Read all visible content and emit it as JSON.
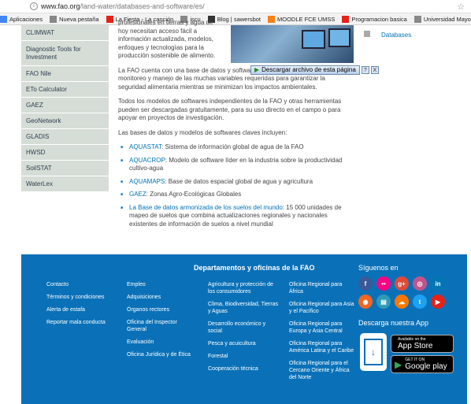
{
  "browser": {
    "url_host": "www.fao.org",
    "url_path": "/land-water/databases-and-software/es/",
    "bookmarks": [
      {
        "label": "Aplicaciones",
        "icon": "apps-icon",
        "color": "#4285f4"
      },
      {
        "label": "Nueva pestaña",
        "icon": "page-icon",
        "color": "#888888"
      },
      {
        "label": "La Fiesta - La canción",
        "icon": "youtube-icon",
        "color": "#e62117"
      },
      {
        "label": "iscu",
        "icon": "page-icon",
        "color": "#888888"
      },
      {
        "label": "Blog | sawersbot",
        "icon": "blog-icon",
        "color": "#333333"
      },
      {
        "label": "MOODLE FCE UMSS",
        "icon": "moodle-icon",
        "color": "#f98012"
      },
      {
        "label": "Programacion basica",
        "icon": "youtube-icon",
        "color": "#e62117"
      },
      {
        "label": "Universidad Mayor d",
        "icon": "page-icon",
        "color": "#888888"
      }
    ]
  },
  "sidebar": {
    "items": [
      "CLIMWAT",
      "Diagnostic Tools for Investment",
      "FAO Nile",
      "ETo Calculator",
      "GAEZ",
      "GeoNetwork",
      "GLADIS",
      "HWSD",
      "SoilSTAT",
      "WaterLex"
    ]
  },
  "main": {
    "p1": "profesionales en tierras y agua de hoy necesitan acceso fácil a información actualizada, modelos, enfoques y tecnologías para la producción sostenible de alimento.",
    "p2": "La FAO cuenta con una base de datos y software de última generación para el monitoreo y manejo de las muchas variables requeridas para garantizar la seguridad alimentaria mientras se minimizan los impactos ambientales.",
    "p3": "Todos los modelos de softwares independientes de la FAO y otras herramientas pueden ser descargadas gratuitamente, para su uso directo en el campo o para apoyar en proyectos de investigación.",
    "p4": "Las bases de datos y modelos de softwares claves incluyen:",
    "list": [
      {
        "link": "AQUASTAT",
        "text": ": Sistema de información global de agua de la FAO"
      },
      {
        "link": "AQUACROP",
        "text": ": Modelo de software líder en la industria sobre la productividad cultivo-agua"
      },
      {
        "link": "AQUAMAPS",
        "text": ": Base de datos espacial global de agua y agricultura"
      },
      {
        "link": "GAEZ",
        "text": ": Zonas Agro-Ecológicas Globales"
      },
      {
        "link": "La Base de datos armonizada de los suelos del mundo",
        "text": ": 15 000 unidades de mapeo de suelos que combina actualizaciones regionales y nacionales existentes de información de suelos a nivel mundial"
      }
    ]
  },
  "download_bar": {
    "label": "Descargar archivo de esta página",
    "help": "?",
    "close": "X"
  },
  "right_link": "Databases",
  "footer": {
    "heading": "Departamentos y oficinas de la FAO",
    "col1": [
      "Contacto",
      "Términos y condiciones",
      "Alerta de estafa",
      "Reportar mala conducta"
    ],
    "col2": [
      "Empleo",
      "Adquisiciones",
      "Órganos rectores",
      "Oficina del Inspector General",
      "Evaluación",
      "Oficina Jurídica y de Ética"
    ],
    "col3": [
      "Agricultura y protección de los consumidores",
      "Clima, Biodiversidad, Tierras y Aguas",
      "Desarrollo económico y social",
      "Pesca y acuicultura",
      "Forestal",
      "Cooperación técnica"
    ],
    "col4": [
      "Oficina Regional para África",
      "Oficina Regional para Asia y el Pacífico",
      "Oficina Regional para Europa y Asia Central",
      "Oficina Regional para América Latina y el Caribe",
      "Oficina Regional para el Cercano Oriente y África del Norte"
    ],
    "follow": "Síguenos en",
    "social": [
      {
        "name": "facebook-icon",
        "glyph": "f",
        "color": "#3b5998"
      },
      {
        "name": "flickr-icon",
        "glyph": "••",
        "color": "#ff0084"
      },
      {
        "name": "googleplus-icon",
        "glyph": "g+",
        "color": "#dd4b39"
      },
      {
        "name": "instagram-icon",
        "glyph": "◎",
        "color": "#c1558b"
      },
      {
        "name": "linkedin-icon",
        "glyph": "in",
        "color": "#0077b5"
      },
      {
        "name": "rss-icon",
        "glyph": "◉",
        "color": "#f26522"
      },
      {
        "name": "slideshare-icon",
        "glyph": "▤",
        "color": "#2f9bb5"
      },
      {
        "name": "soundcloud-icon",
        "glyph": "☁",
        "color": "#ff7700"
      },
      {
        "name": "twitter-icon",
        "glyph": "t",
        "color": "#1da1f2"
      },
      {
        "name": "youtube-icon",
        "glyph": "▶",
        "color": "#e62117"
      }
    ],
    "download_app": "Descarga nuestra App",
    "appstore_small": "Available on the",
    "appstore_big": "App Store",
    "play_small": "GET IT ON",
    "play_big": "Google play"
  }
}
